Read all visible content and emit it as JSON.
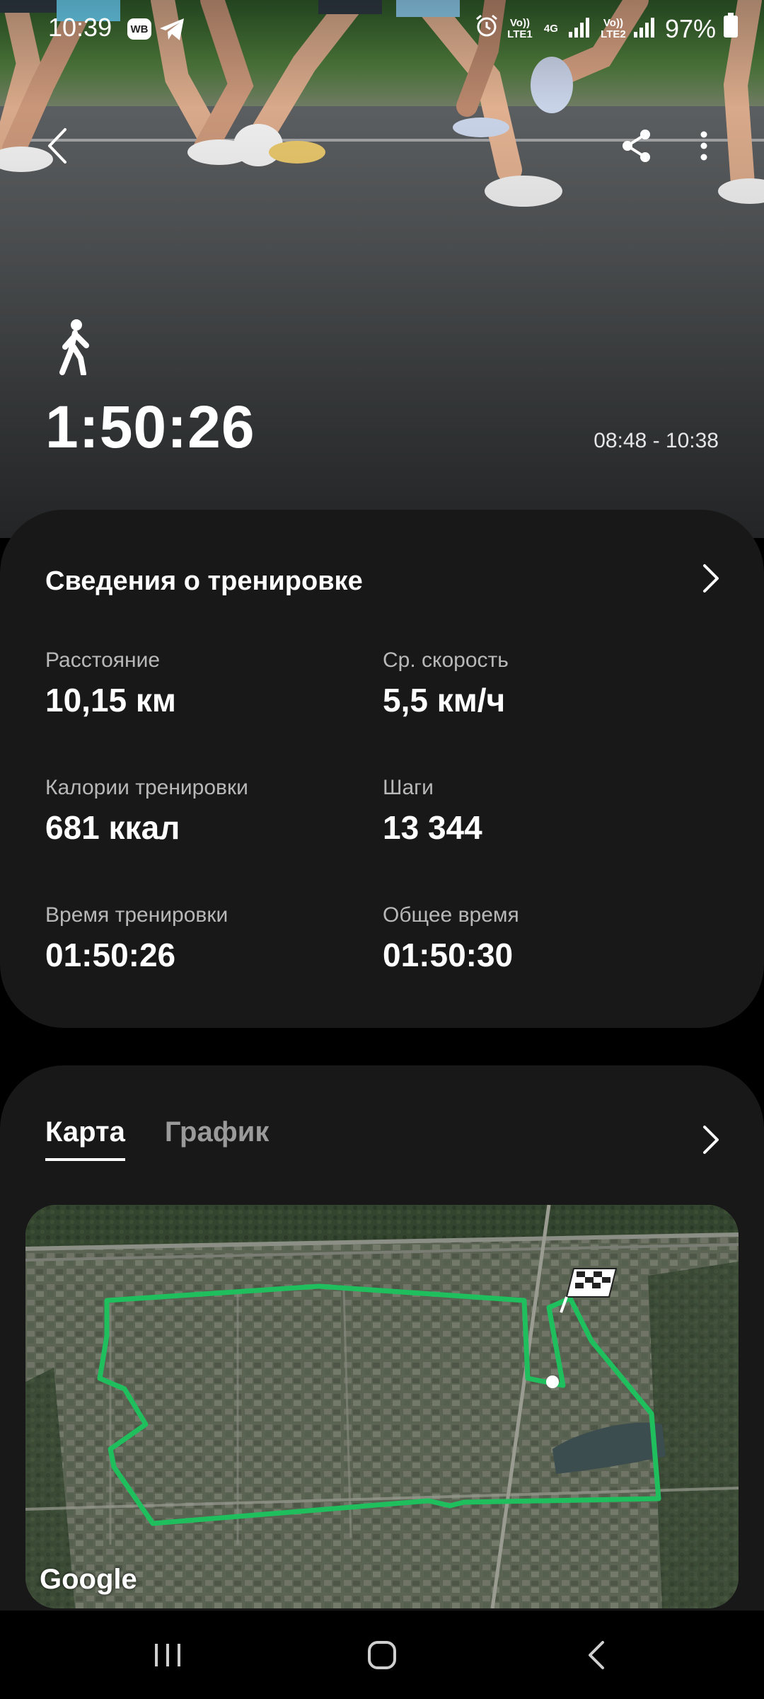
{
  "status_bar": {
    "time": "10:39",
    "app_badge": "WB",
    "network1": "Vo)) LTE1",
    "network_type": "4G",
    "network2": "Vo)) LTE2",
    "battery_pct": "97%"
  },
  "hero": {
    "activity_icon": "walking-person-icon",
    "duration": "1:50:26",
    "time_range": "08:48 - 10:38"
  },
  "details": {
    "title": "Сведения о тренировке",
    "stats": [
      {
        "label": "Расстояние",
        "value": "10,15 км"
      },
      {
        "label": "Ср. скорость",
        "value": "5,5 км/ч"
      },
      {
        "label": "Калории тренировки",
        "value": "681 ккал"
      },
      {
        "label": "Шаги",
        "value": "13 344"
      },
      {
        "label": "Время тренировки",
        "value": "01:50:26"
      },
      {
        "label": "Общее время",
        "value": "01:50:30"
      }
    ]
  },
  "map_section": {
    "tabs": [
      {
        "label": "Карта",
        "active": true
      },
      {
        "label": "График",
        "active": false
      }
    ],
    "attribution": "Google",
    "route_color": "#1fbf5e"
  },
  "colors": {
    "card_bg": "#181818",
    "page_bg": "#000000",
    "label_gray": "#b8b8b8"
  }
}
